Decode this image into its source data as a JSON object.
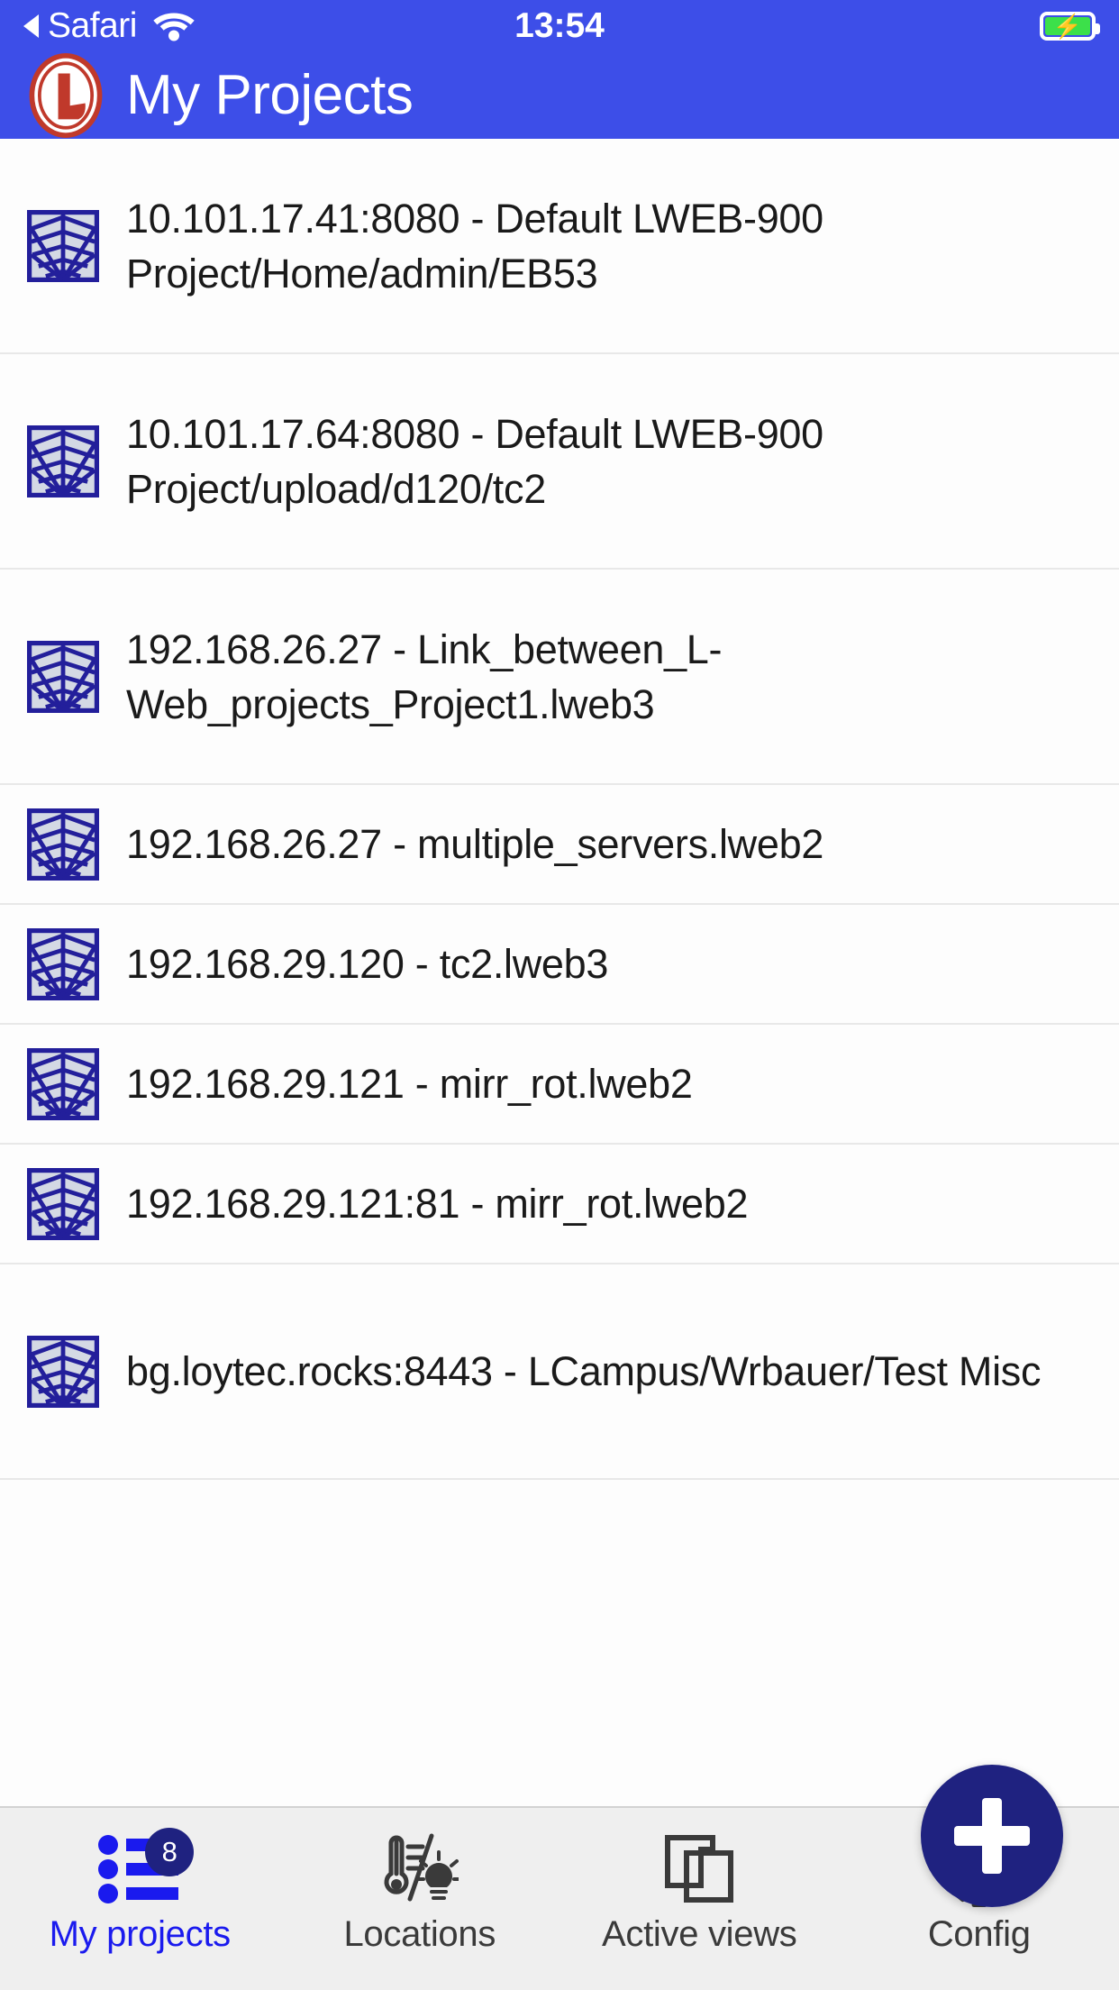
{
  "status_bar": {
    "back_label": "Safari",
    "back_icon": "back-triangle-icon",
    "wifi_icon": "wifi-icon",
    "time": "13:54",
    "battery_icon": "battery-charging-icon",
    "battery_color": "#3CE04A"
  },
  "nav_bar": {
    "title": "My Projects",
    "logo_icon": "loytec-l-logo-icon",
    "background_color": "#3D4EE8",
    "text_color": "#FFFFFF"
  },
  "list": {
    "row_icon": "spider-web-project-icon",
    "items": [
      {
        "label": "10.101.17.41:8080 - Default LWEB-900 Project/Home/admin/EB53",
        "lines": 2
      },
      {
        "label": "10.101.17.64:8080 - Default LWEB-900 Project/upload/d120/tc2",
        "lines": 2
      },
      {
        "label": "192.168.26.27 - Link_between_L-Web_projects_Project1.lweb3",
        "lines": 2
      },
      {
        "label": "192.168.26.27 - multiple_servers.lweb2",
        "lines": 1
      },
      {
        "label": "192.168.29.120 - tc2.lweb3",
        "lines": 1
      },
      {
        "label": "192.168.29.121 - mirr_rot.lweb2",
        "lines": 1
      },
      {
        "label": "192.168.29.121:81 - mirr_rot.lweb2",
        "lines": 1
      },
      {
        "label": "bg.loytec.rocks:8443 - LCampus/Wrbauer/Test Misc",
        "lines": 2
      }
    ]
  },
  "fab": {
    "icon": "plus-icon",
    "label": "Add project",
    "color": "#1F2280"
  },
  "tab_bar": {
    "accent_color": "#1A1AEE",
    "tabs": [
      {
        "label": "My projects",
        "icon": "bulleted-list-icon",
        "active": true,
        "badge": "8"
      },
      {
        "label": "Locations",
        "icon": "thermometer-lightbulb-icon",
        "active": false,
        "badge": ""
      },
      {
        "label": "Active views",
        "icon": "copy-windows-icon",
        "active": false,
        "badge": ""
      },
      {
        "label": "Config",
        "icon": "gear-icon",
        "active": false,
        "badge": ""
      }
    ]
  }
}
